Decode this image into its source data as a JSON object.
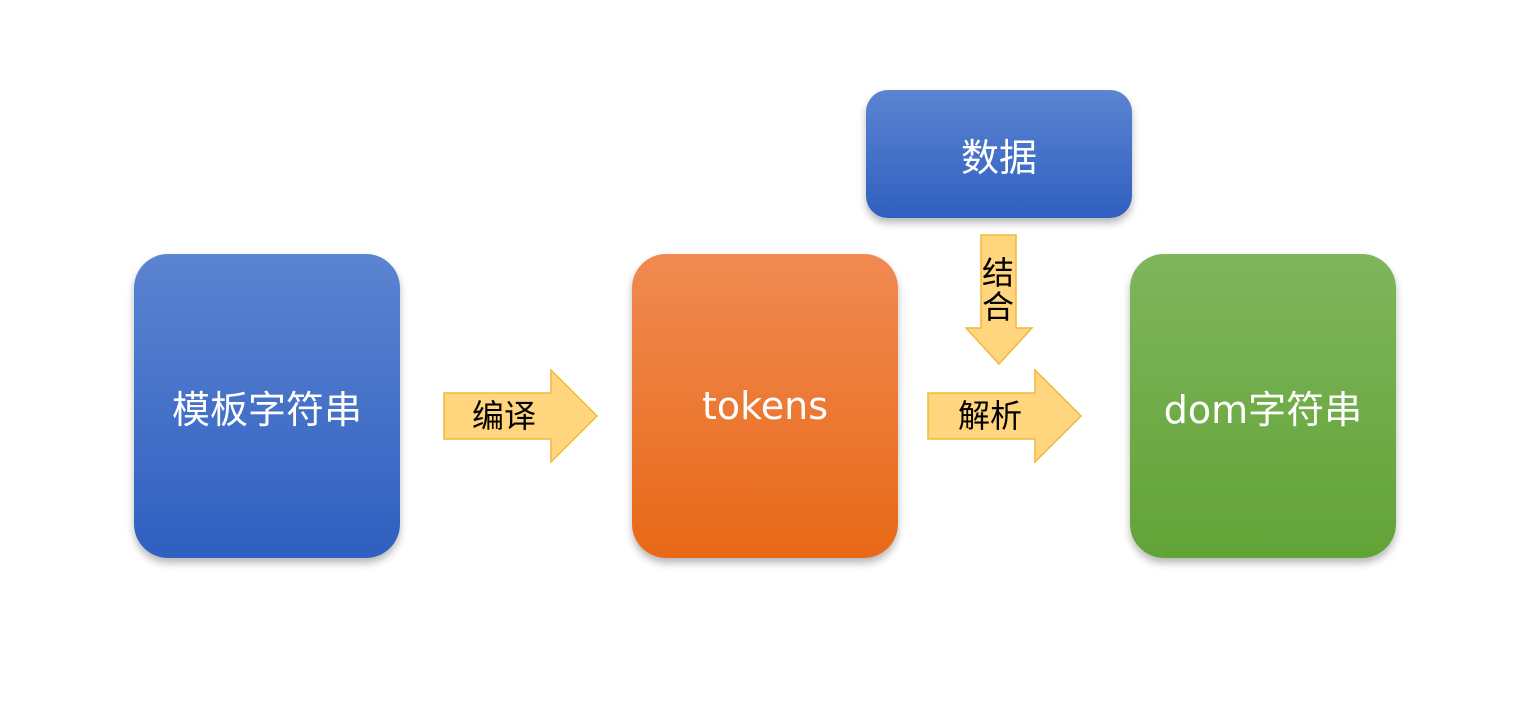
{
  "diagram": {
    "nodes": {
      "template": {
        "label": "模板字符串"
      },
      "tokens": {
        "label": "tokens"
      },
      "dom": {
        "label": "dom字符串"
      },
      "data": {
        "label": "数据"
      }
    },
    "edges": {
      "compile": {
        "label": "编译"
      },
      "parse": {
        "label": "解析"
      },
      "combine": {
        "label": "结合"
      }
    }
  }
}
